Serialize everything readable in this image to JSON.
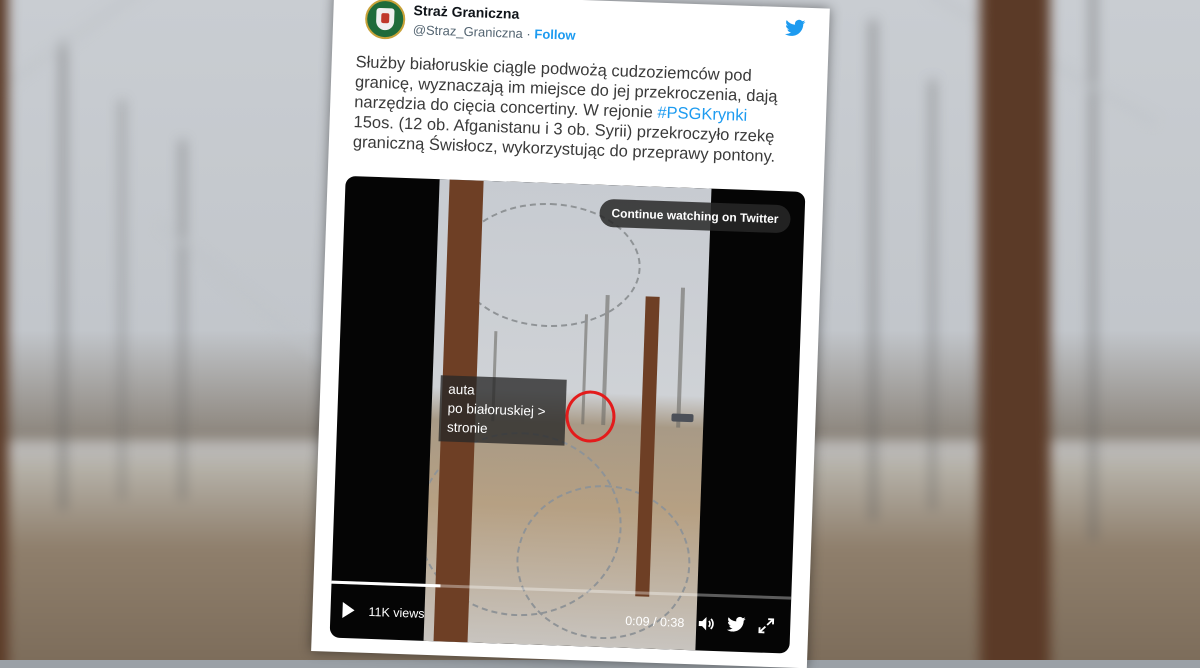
{
  "tweet": {
    "account_name": "Straż Graniczna",
    "handle": "@Straz_Graniczna",
    "separator": "·",
    "follow_label": "Follow",
    "text_lines": [
      "Służby białoruskie ciągle podwożą cudzoziemców pod",
      "granicę, wyznaczają im miejsce do jej przekroczenia, dają",
      "narzędzia do cięcia concertiny. W rejonie ",
      "15os. (12 ob. Afganistanu i 3 ob. Syrii) przekroczyło rzekę",
      "graniczną Świsłocz, wykorzystując do przeprawy pontony."
    ],
    "hashtag": "#PSGKrynki"
  },
  "video": {
    "continue_label": "Continue watching on Twitter",
    "annotation_lines": [
      "auta",
      "po białoruskiej >",
      "stronie"
    ],
    "views": "11K views",
    "current_time": "0:09",
    "duration": "0:38",
    "time_separator": " / ",
    "progress": 0.237
  },
  "colors": {
    "accent": "#1d9bf0",
    "highlight_circle": "#e31b1b"
  },
  "icons": [
    "twitter-bird-icon",
    "play-icon",
    "volume-icon",
    "twitter-icon",
    "fullscreen-icon"
  ]
}
